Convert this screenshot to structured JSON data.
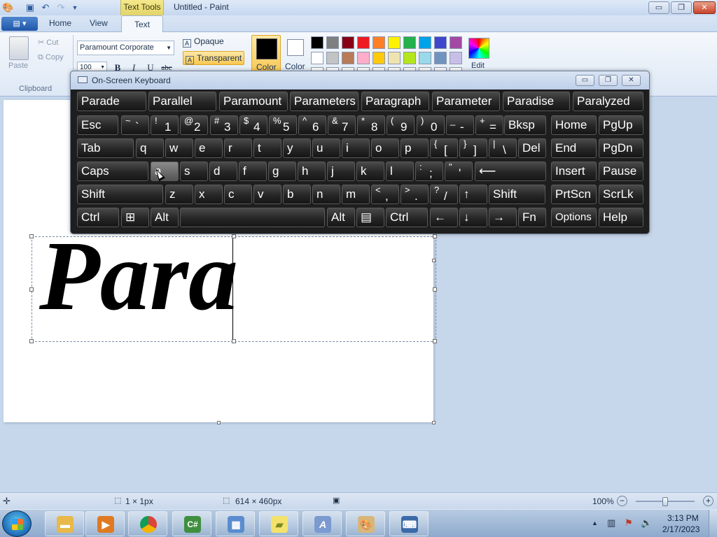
{
  "window": {
    "title": "Untitled - Paint",
    "contextual_tab_header": "Text Tools",
    "minimize": "▭",
    "maximize": "❐",
    "close": "✕"
  },
  "quick_access": {
    "app_icon": "paint-app-icon",
    "save_icon": "save-icon",
    "undo_icon": "undo-icon",
    "redo_icon": "redo-icon",
    "customize_icon": "dropdown-arrow-icon"
  },
  "ribbon": {
    "app_menu_icon": "menu-icon",
    "tabs": [
      "Home",
      "View",
      "Text"
    ],
    "active_tab": "Text",
    "help_icon": "help-icon",
    "clipboard": {
      "paste_label": "Paste",
      "cut_label": "Cut",
      "copy_label": "Copy",
      "group_label": "Clipboard"
    },
    "font": {
      "family": "Paramount Corporate",
      "size": "100",
      "bold": "B",
      "italic": "I",
      "underline": "U",
      "strikethrough": "abc"
    },
    "background": {
      "opaque_label": "Opaque",
      "transparent_label": "Transparent",
      "selected": "Transparent"
    },
    "colors": {
      "color1_label": "Color",
      "color2_label": "Color",
      "color1_value": "#000000",
      "color2_value": "#ffffff",
      "edit_label": "Edit",
      "palette_row1": [
        "#000000",
        "#7f7f7f",
        "#880015",
        "#ed1c24",
        "#ff7f27",
        "#fff200",
        "#22b14c",
        "#00a2e8",
        "#3f48cc",
        "#a349a4"
      ],
      "palette_row2": [
        "#ffffff",
        "#c3c3c3",
        "#b97a57",
        "#ffaec9",
        "#ffc90e",
        "#efe4b0",
        "#b5e61d",
        "#99d9ea",
        "#7092be",
        "#c8bfe7"
      ]
    }
  },
  "canvas": {
    "text": "Para",
    "text_color": "#000000"
  },
  "keyboard": {
    "title": "On-Screen Keyboard",
    "icon": "keyboard-icon",
    "min": "▭",
    "max": "❐",
    "close": "✕",
    "predictions": [
      "Parade",
      "Parallel",
      "Paramount",
      "Parameters",
      "Paragraph",
      "Parameter",
      "Paradise",
      "Paralyzed"
    ],
    "row1": [
      {
        "label": "Esc"
      },
      {
        "shift": "~",
        "main": "`"
      },
      {
        "shift": "!",
        "main": "1"
      },
      {
        "shift": "@",
        "main": "2"
      },
      {
        "shift": "#",
        "main": "3"
      },
      {
        "shift": "$",
        "main": "4"
      },
      {
        "shift": "%",
        "main": "5"
      },
      {
        "shift": "^",
        "main": "6"
      },
      {
        "shift": "&",
        "main": "7"
      },
      {
        "shift": "*",
        "main": "8"
      },
      {
        "shift": "(",
        "main": "9"
      },
      {
        "shift": ")",
        "main": "0"
      },
      {
        "shift": "_",
        "main": "-"
      },
      {
        "shift": "+",
        "main": "="
      },
      {
        "label": "Bksp"
      },
      {
        "label": "Home"
      },
      {
        "label": "PgUp"
      }
    ],
    "row2": [
      {
        "label": "Tab"
      },
      {
        "label": "q"
      },
      {
        "label": "w"
      },
      {
        "label": "e"
      },
      {
        "label": "r"
      },
      {
        "label": "t"
      },
      {
        "label": "y"
      },
      {
        "label": "u"
      },
      {
        "label": "i"
      },
      {
        "label": "o"
      },
      {
        "label": "p"
      },
      {
        "shift": "{",
        "main": "["
      },
      {
        "shift": "}",
        "main": "]"
      },
      {
        "shift": "|",
        "main": "\\"
      },
      {
        "label": "Del"
      },
      {
        "label": "End"
      },
      {
        "label": "PgDn"
      }
    ],
    "row3": [
      {
        "label": "Caps"
      },
      {
        "label": "a"
      },
      {
        "label": "s"
      },
      {
        "label": "d"
      },
      {
        "label": "f"
      },
      {
        "label": "g"
      },
      {
        "label": "h"
      },
      {
        "label": "j"
      },
      {
        "label": "k"
      },
      {
        "label": "l"
      },
      {
        "shift": ":",
        "main": ";"
      },
      {
        "shift": "\"",
        "main": "'"
      },
      {
        "label": "⟵"
      },
      {
        "label": "Insert"
      },
      {
        "label": "Pause"
      }
    ],
    "row4": [
      {
        "label": "Shift"
      },
      {
        "label": "z"
      },
      {
        "label": "x"
      },
      {
        "label": "c"
      },
      {
        "label": "v"
      },
      {
        "label": "b"
      },
      {
        "label": "n"
      },
      {
        "label": "m"
      },
      {
        "shift": "<",
        "main": ","
      },
      {
        "shift": ">",
        "main": "."
      },
      {
        "shift": "?",
        "main": "/"
      },
      {
        "label": "↑"
      },
      {
        "label": "Shift"
      },
      {
        "label": "PrtScn"
      },
      {
        "label": "ScrLk"
      }
    ],
    "row5": [
      {
        "label": "Ctrl"
      },
      {
        "label": "⊞"
      },
      {
        "label": "Alt"
      },
      {
        "label": ""
      },
      {
        "label": "Alt"
      },
      {
        "label": "▤"
      },
      {
        "label": "Ctrl"
      },
      {
        "label": "←"
      },
      {
        "label": "↓"
      },
      {
        "label": "→"
      },
      {
        "label": "Fn"
      },
      {
        "label": "Options"
      },
      {
        "label": "Help"
      }
    ],
    "pressed_key": "a"
  },
  "status": {
    "move_icon": "move-icon",
    "selection_icon": "selection-icon",
    "selection_size": "1 × 1px",
    "canvas_size_icon": "canvas-size-icon",
    "canvas_size": "614 × 460px",
    "disk_icon": "disk-icon",
    "zoom": "100%",
    "zoom_out": "−",
    "zoom_in": "+"
  },
  "taskbar": {
    "apps": [
      "explorer-icon",
      "media-player-icon",
      "chrome-icon",
      "csharp-icon",
      "paint-window-icon",
      "sticky-notes-icon",
      "font-icon",
      "paint-icon",
      "keyboard-icon"
    ],
    "time": "3:13 PM",
    "date": "2/17/2023"
  }
}
